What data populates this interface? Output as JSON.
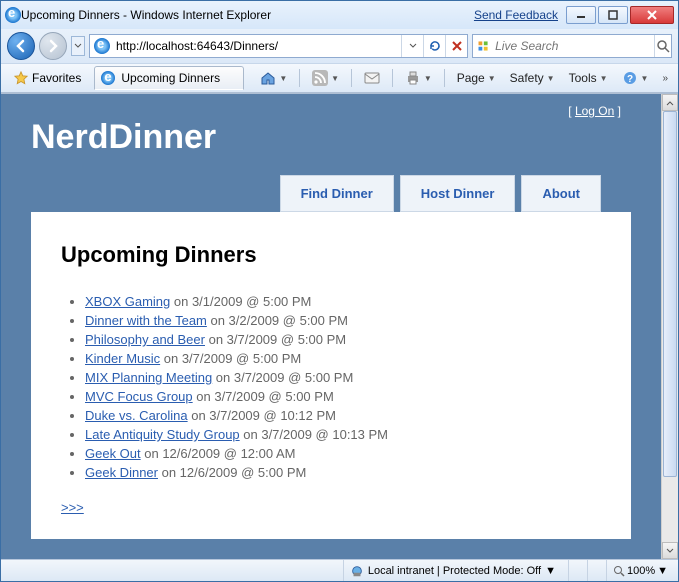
{
  "window": {
    "title": "Upcoming Dinners - Windows Internet Explorer",
    "feedback": "Send Feedback"
  },
  "nav": {
    "url": "http://localhost:64643/Dinners/",
    "search_placeholder": "Live Search"
  },
  "cmdbar": {
    "favorites": "Favorites",
    "tab_title": "Upcoming Dinners",
    "page": "Page",
    "safety": "Safety",
    "tools": "Tools"
  },
  "site": {
    "logon_label": "Log On",
    "title": "NerdDinner",
    "menu": [
      {
        "label": "Find Dinner"
      },
      {
        "label": "Host Dinner"
      },
      {
        "label": "About"
      }
    ],
    "heading": "Upcoming Dinners",
    "dinners": [
      {
        "title": "XBOX Gaming",
        "when": " on 3/1/2009 @ 5:00 PM"
      },
      {
        "title": "Dinner with the Team",
        "when": " on 3/2/2009 @ 5:00 PM"
      },
      {
        "title": "Philosophy and Beer",
        "when": " on 3/7/2009 @ 5:00 PM"
      },
      {
        "title": "Kinder Music",
        "when": " on 3/7/2009 @ 5:00 PM"
      },
      {
        "title": "MIX Planning Meeting",
        "when": " on 3/7/2009 @ 5:00 PM"
      },
      {
        "title": "MVC Focus Group",
        "when": " on 3/7/2009 @ 5:00 PM"
      },
      {
        "title": "Duke vs. Carolina",
        "when": " on 3/7/2009 @ 10:12 PM"
      },
      {
        "title": "Late Antiquity Study Group",
        "when": " on 3/7/2009 @ 10:13 PM"
      },
      {
        "title": "Geek Out",
        "when": " on 12/6/2009 @ 12:00 AM"
      },
      {
        "title": "Geek Dinner",
        "when": " on 12/6/2009 @ 5:00 PM"
      }
    ],
    "pager": ">>>"
  },
  "status": {
    "zone": "Local intranet | Protected Mode: Off",
    "zoom": "100%"
  }
}
